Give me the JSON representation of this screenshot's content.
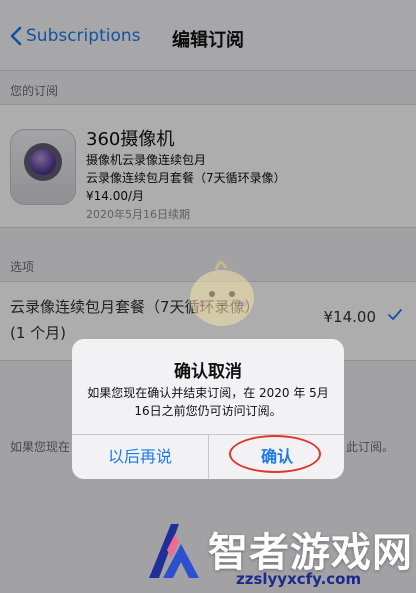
{
  "navbar": {
    "back_label": "Subscriptions",
    "title": "编辑订阅"
  },
  "subscription_section": {
    "label": "您的订阅",
    "app_name": "360摄像机",
    "plan_name": "摄像机云录像连续包月",
    "plan_desc": "云录像连续包月套餐（7天循环录像）",
    "price": "¥14.00/月",
    "renew_date": "2020年5月16日续期"
  },
  "options_section": {
    "label": "选项",
    "option_line1": "云录像连续包月套餐（7天循环录像）",
    "option_line2": "(1 个月)",
    "option_price": "¥14.00",
    "option_selected": true
  },
  "footer_info": {
    "left": "如果您现在",
    "right": "此订阅。"
  },
  "alert": {
    "title": "确认取消",
    "message": "如果您现在确认并结束订阅，在 2020 年 5月16日之前您仍可访问订阅。",
    "cancel_label": "以后再说",
    "confirm_label": "确认"
  },
  "watermark": {
    "brand": "智者游戏网",
    "url": "zzslyyxcfy.com",
    "logo_icon": "chevron-logo-icon",
    "mascot_icon": "chick-mascot-icon"
  },
  "colors": {
    "accent": "#1a7bf0",
    "highlight_circle": "#e0352b"
  }
}
